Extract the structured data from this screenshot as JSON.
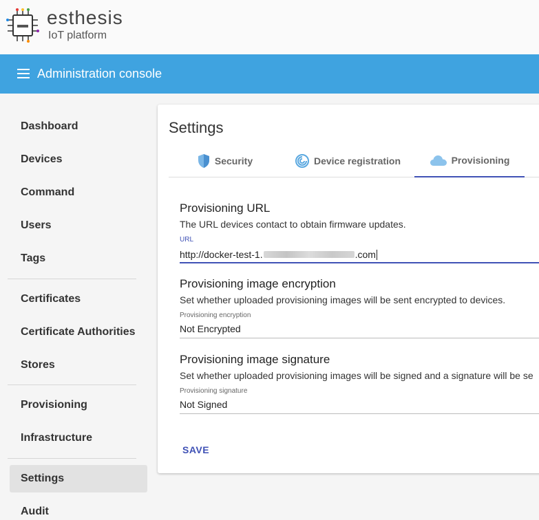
{
  "brand": {
    "name": "esthesis",
    "subtitle": "IoT platform"
  },
  "appbar": {
    "title": "Administration console"
  },
  "nav": {
    "items": [
      {
        "label": "Dashboard"
      },
      {
        "label": "Devices"
      },
      {
        "label": "Command"
      },
      {
        "label": "Users"
      },
      {
        "label": "Tags"
      },
      {
        "label": "Certificates"
      },
      {
        "label": "Certificate Authorities"
      },
      {
        "label": "Stores"
      },
      {
        "label": "Provisioning"
      },
      {
        "label": "Infrastructure"
      },
      {
        "label": "Settings"
      },
      {
        "label": "Audit"
      }
    ],
    "active": "Settings"
  },
  "settings": {
    "title": "Settings",
    "tabs": [
      {
        "label": "Security",
        "icon": "shield-icon"
      },
      {
        "label": "Device registration",
        "icon": "fingerprint-icon"
      },
      {
        "label": "Provisioning",
        "icon": "cloud-icon"
      }
    ],
    "active_tab": "Provisioning",
    "sections": {
      "url": {
        "title": "Provisioning URL",
        "description": "The URL devices contact to obtain firmware updates.",
        "field_label": "URL",
        "value_prefix": "http://docker-test-1.",
        "value_suffix": ".com"
      },
      "encryption": {
        "title": "Provisioning image encryption",
        "description": "Set whether uploaded provisioning images will be sent encrypted to devices.",
        "field_label": "Provisioning encryption",
        "value": "Not Encrypted"
      },
      "signature": {
        "title": "Provisioning image signature",
        "description": "Set whether uploaded provisioning images will be signed and a signature will be se",
        "field_label": "Provisioning signature",
        "value": "Not Signed"
      }
    },
    "save_label": "SAVE"
  },
  "colors": {
    "appbar": "#3fa3e0",
    "accent": "#3f51b5",
    "active_nav": "#e2e2e2"
  }
}
